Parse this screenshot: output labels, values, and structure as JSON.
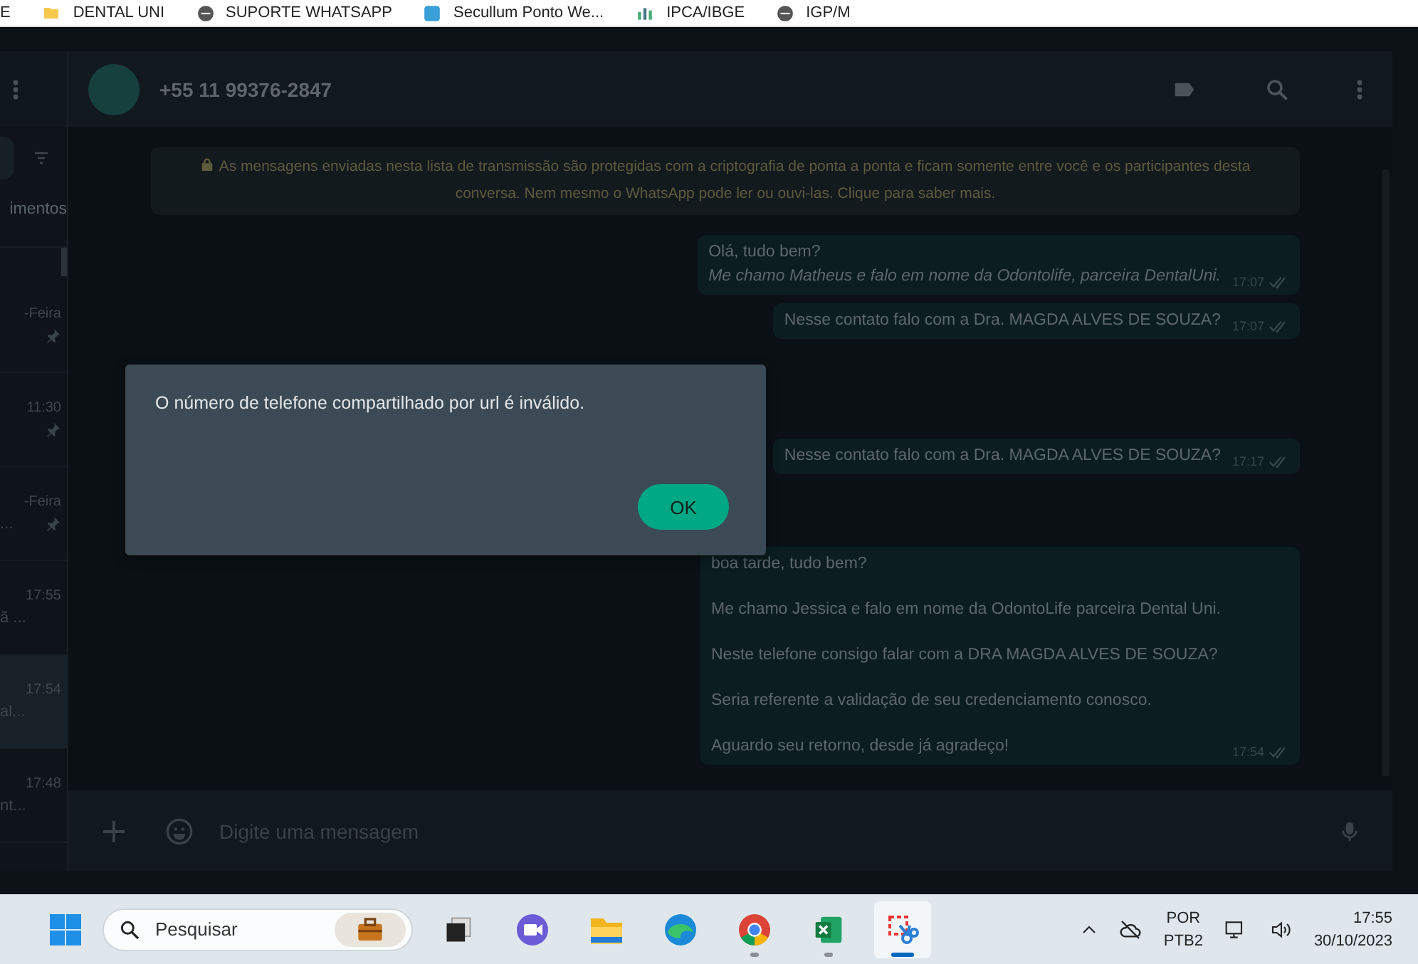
{
  "bookmarks": [
    {
      "kind": "fragment",
      "label": "E"
    },
    {
      "kind": "folder",
      "label": "DENTAL UNI"
    },
    {
      "kind": "site",
      "label": "SUPORTE WHATSAPP"
    },
    {
      "kind": "app",
      "label": "Secullum Ponto We..."
    },
    {
      "kind": "chart",
      "label": "IPCA/IBGE"
    },
    {
      "kind": "site",
      "label": "IGP/M"
    }
  ],
  "sidebar": {
    "section_label": "imentos",
    "chats": [
      {
        "time": "-Feira",
        "pinned": true,
        "selected": false
      },
      {
        "time": "11:30",
        "pinned": true,
        "selected": false
      },
      {
        "time": "-Feira",
        "preview": "...",
        "pinned": true,
        "selected": false
      },
      {
        "time": "17:55",
        "preview": "ã ...",
        "pinned": false,
        "selected": false
      },
      {
        "time": "17:54",
        "preview": "al...",
        "pinned": false,
        "selected": true
      },
      {
        "time": "17:48",
        "preview": "nt...",
        "pinned": false,
        "selected": false
      }
    ]
  },
  "chat": {
    "contact": "+55 11 99376-2847",
    "notice": "As mensagens enviadas nesta lista de transmissão são protegidas com a criptografia de ponta a ponta e ficam somente entre você e os participantes desta conversa. Nem mesmo o WhatsApp pode ler ou ouvi-las. Clique para saber mais.",
    "messages": [
      {
        "lines": [
          "Olá, tudo bem?",
          "*Me chamo Matheus e falo em nome da Odontolife, parceira DentalUni.*"
        ],
        "time": "17:07"
      },
      {
        "lines": [
          "Nesse contato falo com a Dra. MAGDA ALVES DE SOUZA?"
        ],
        "time": "17:07"
      },
      {
        "lines": [
          "Nesse contato falo com a Dra. MAGDA ALVES DE SOUZA?"
        ],
        "time": "17:17"
      },
      {
        "lines": [
          "boa tarde, tudo bem?",
          "Me chamo Jessica e falo em nome da OdontoLife parceira Dental Uni.",
          "Neste telefone consigo falar com a DRA MAGDA ALVES DE SOUZA?",
          "Seria referente a validação de seu credenciamento conosco.",
          "Aguardo seu retorno, desde já agradeço!"
        ],
        "time": "17:54"
      }
    ],
    "composer": {
      "placeholder": "Digite uma mensagem"
    }
  },
  "dialog": {
    "message": "O número de telefone compartilhado por url é inválido.",
    "button": "OK"
  },
  "taskbar": {
    "search": {
      "placeholder": "Pesquisar"
    },
    "apps": [
      {
        "kind": "taskview",
        "running": false,
        "selected": false
      },
      {
        "kind": "meet",
        "running": false,
        "selected": false
      },
      {
        "kind": "folder",
        "running": false,
        "selected": false
      },
      {
        "kind": "edge",
        "running": false,
        "selected": false
      },
      {
        "kind": "chrome",
        "running": true,
        "selected": false
      },
      {
        "kind": "excel",
        "running": true,
        "selected": false
      },
      {
        "kind": "snip",
        "running": true,
        "selected": true
      }
    ],
    "language": [
      "POR",
      "PTB2"
    ],
    "time": "17:55",
    "date": "30/10/2023"
  }
}
